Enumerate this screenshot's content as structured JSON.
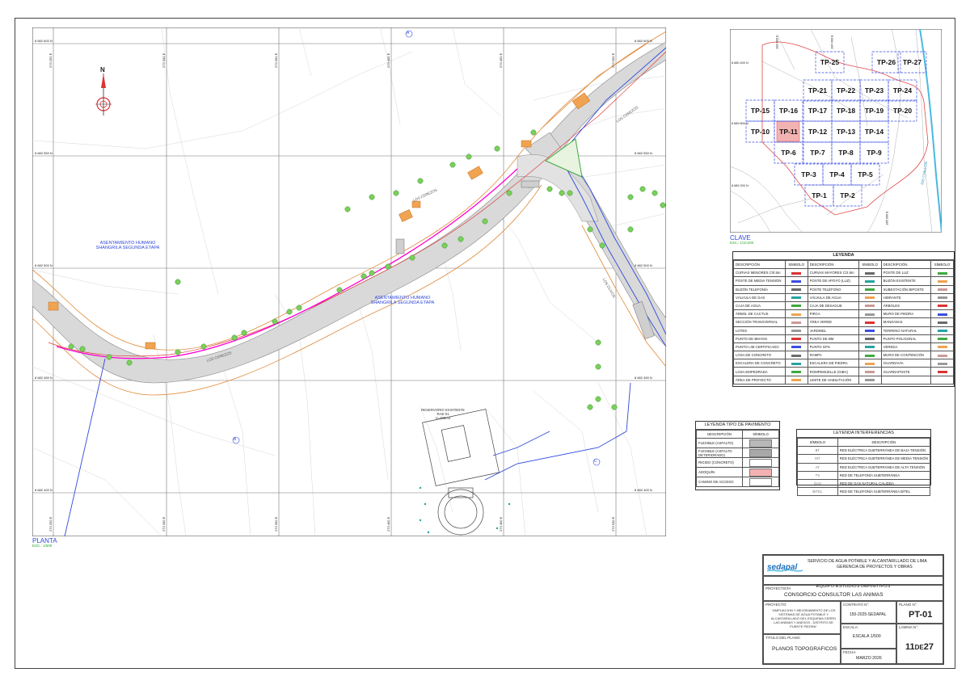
{
  "plan": {
    "title": "PLANTA",
    "scale": "ESC.: 1/500",
    "north_label": "N",
    "grid_north": [
      "8 682 600 N",
      "8 682 550 N",
      "8 682 500 N",
      "8 682 450 N",
      "8 682 400 N"
    ],
    "grid_east": [
      "273 250 E",
      "273 300 E",
      "273 350 E",
      "273 400 E",
      "273 450 E",
      "273 500 E"
    ],
    "labels": {
      "asent1_l1": "ASENTAMIENTO HUMANO",
      "asent1_l2": "SHANGRILA SEGUNDA ETAPA",
      "asent2_l1": "ASENTAMIENTO HUMANO",
      "asent2_l2": "SHANGRILA SEGUNDA ETAPA",
      "street1": "LOS CEREZOS",
      "street2": "LOS CEREZOS",
      "street3": "LOS CEREZOS",
      "street4": "LOS OLIVOS",
      "res_l1": "RESERVORIO EXISTENTE",
      "res_l2": "RAE-01",
      "res_l3": "V=300m3",
      "marker_a": "A",
      "marker_b": "B",
      "marker_c": "C"
    }
  },
  "key_map": {
    "title": "CLAVE",
    "scale": "ESC.: 1/10,000",
    "tiles": [
      "TP-25",
      "TP-26",
      "TP-27",
      "TP-21",
      "TP-22",
      "TP-23",
      "TP-24",
      "TP-15",
      "TP-16",
      "TP-17",
      "TP-18",
      "TP-19",
      "TP-20",
      "TP-10",
      "TP-11",
      "TP-12",
      "TP-13",
      "TP-14",
      "TP-6",
      "TP-7",
      "TP-8",
      "TP-9",
      "TP-3",
      "TP-4",
      "TP-5",
      "TP-1",
      "TP-2"
    ],
    "active_tile": "TP-11",
    "north_coords": [
      "8 680 400 N",
      "8 689 800 N",
      "8 689 200 N"
    ],
    "east_coords": [
      "283 800 E",
      "284 400 E",
      "285 000 E"
    ],
    "river": "RIO CHILLON"
  },
  "legend": {
    "title": "LEYENDA",
    "header": [
      "DESCRIPCIÓN",
      "SÍMBOLO",
      "DESCRIPCIÓN",
      "SÍMBOLO",
      "DESCRIPCIÓN",
      "SÍMBOLO"
    ],
    "rows": [
      [
        "CURVAS MENORES C/0.5m",
        "",
        "CURVAS MAYORES C/2.5m",
        "",
        "POSTE DE LUZ",
        ""
      ],
      [
        "POSTE DE MEDIA TENSIÓN",
        "",
        "POSTE DE APOYO (LUZ)",
        "",
        "BUZÓN EXISTENTE",
        ""
      ],
      [
        "BUZÓN TELEFONÍA",
        "",
        "POSTE TELÉFONO",
        "",
        "SUBESTACIÓN BIPOSTE",
        ""
      ],
      [
        "VÁLVULA DE GAS",
        "",
        "VÁLVULA DE AGUA",
        "",
        "HIDRANTE",
        ""
      ],
      [
        "CAJA DE AGUA",
        "",
        "CAJA DE DESAGUE",
        "",
        "ÁRBOLES",
        ""
      ],
      [
        "ÁRBOL DE CACTUS",
        "",
        "PIRCA",
        "",
        "MURO DE PIEDRA",
        ""
      ],
      [
        "SECCIÓN TRANSVERSAL",
        "",
        "ÁREA VERDE",
        "",
        "MANZANAS",
        ""
      ],
      [
        "LOTES",
        "",
        "JARDINEL",
        "",
        "TERRENO NATURAL",
        ""
      ],
      [
        "PUNTO DE BM-IGN",
        "",
        "PUNTO DE BM",
        "",
        "PUNTO POLIGONAL",
        ""
      ],
      [
        "PUNTO LIM CERTIFICADO",
        "",
        "PUNTO GPS",
        "",
        "VEREDA",
        ""
      ],
      [
        "LOSA DE CONCRETO",
        "",
        "RAMPA",
        "",
        "MURO DE CONTENCIÓN",
        ""
      ],
      [
        "ESCALERA DE CONCRETO",
        "",
        "ESCALERA DE PIEDRA",
        "",
        "GUARDAVIA",
        ""
      ],
      [
        "LOSA EMPEDRADA",
        "",
        "ROMPEMUELLE (GIBA)",
        "",
        "GUARDAPOSTE",
        ""
      ],
      [
        "ÁREA DE PROYECTO",
        "",
        "LIMITE DE HABILITACIÓN",
        "",
        "",
        ""
      ]
    ]
  },
  "pavement_legend": {
    "title": "LEYENDA TIPO DE PAVIMENTO",
    "header": [
      "DESCRIPCIÓN",
      "SÍMBOLO"
    ],
    "rows": [
      [
        "FLEXIBLE (ASFALTO)"
      ],
      [
        "FLEXIBLE (ASFALTO DETERIORADO)"
      ],
      [
        "RIGIDO (CONCRETO)"
      ],
      [
        "ADOQUÍN"
      ],
      [
        "CAMINO DE ACCESO"
      ]
    ]
  },
  "interference_legend": {
    "title": "LEYENDA INTERFERENCIAS",
    "header": [
      "SÍMBOLO",
      "DESCRIPCIÓN"
    ],
    "rows": [
      [
        "BT",
        "RED ELÉCTRICA SUBTERRÁNEA DE BAJA TENSIÓN"
      ],
      [
        "MT",
        "RED ELÉCTRICA SUBTERRÁNEA DE MEDIA TENSIÓN"
      ],
      [
        "AT",
        "RED ELÉCTRICA SUBTERRÁNEA DE ALTA TENSIÓN"
      ],
      [
        "TS",
        "RED DE TELEFONÍA SUBTERRÁNEA"
      ],
      [
        "GAS",
        "RED DE GAS NATURAL CALIDDA"
      ],
      [
        "BITEL",
        "RED DE TELEFONÍA SUBTERRÁNEA BITEL"
      ]
    ]
  },
  "title_block": {
    "logo": "sedapal",
    "org_l1": "SERVICIO DE AGUA POTABLE Y ALCANTARILLADO DE LIMA",
    "org_l2": "GERENCIA DE PROYECTOS Y OBRAS",
    "team": "EQUIPO ESTUDIOS DEFINITIVOS",
    "proyectista_label": "PROYECTISTA",
    "proyectista": "CONSORCIO CONSULTOR LAS ANIMAS",
    "proyecto_label": "PROYECTO:",
    "proyecto": "\"AMPLIACION Y MEJORAMIENTO DE LOS SISTEMAS DE AGUA POTABLE Y ALCANTARILLADO DEL ESQUEMA CERRO LAS ANIMAS Y ANEXOS - DISTRITO DE PUENTE PIEDRA\"",
    "contrato_label": "CONTRATO N°:",
    "contrato": "150-2025-SEDAPAL",
    "plano_label": "PLANO N°:",
    "plano": "PT-01",
    "escala_label": "ESCALA:",
    "escala": "ESCALA 1/500",
    "lamina_label": "LÁMINA N°:",
    "lamina_num": "11",
    "lamina_de": "DE",
    "lamina_total": "27",
    "titulo_label": "TITULO DEL PLANO:",
    "titulo": "PLANOS TOPOGRAFICOS",
    "fecha_label": "FECHA:",
    "fecha": "MARZO 2026"
  }
}
